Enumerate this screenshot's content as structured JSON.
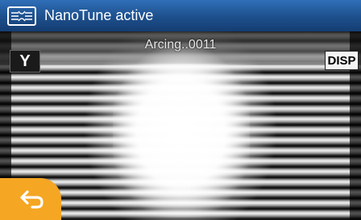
{
  "header": {
    "title": "NanoTune active",
    "icon": "fiber-splicer-icon"
  },
  "status_text": "Arcing..0011",
  "buttons": {
    "y_label": "Y",
    "disp_label": "DISP",
    "back_icon": "back-arrow-icon"
  },
  "colors": {
    "header": "#1d4f8c",
    "back_button": "#f5a623"
  }
}
